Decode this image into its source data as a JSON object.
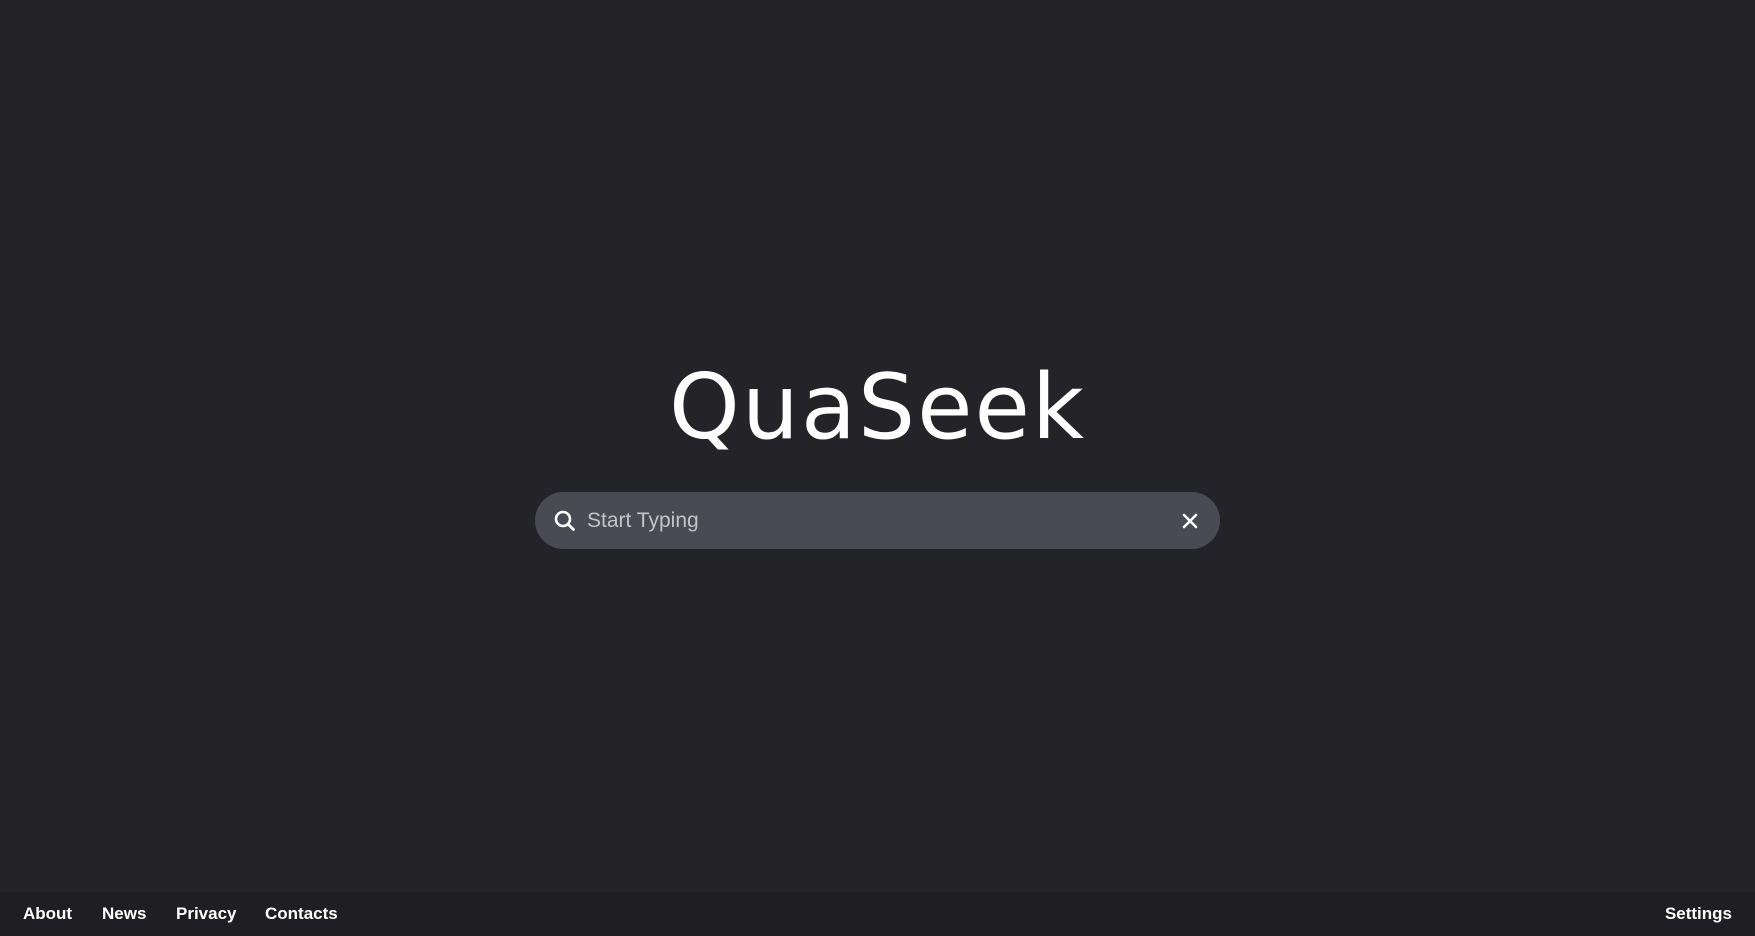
{
  "logo": {
    "text": "QuaSeek"
  },
  "search": {
    "placeholder": "Start Typing",
    "value": ""
  },
  "icons": {
    "search": "search-icon",
    "clear": "close-icon"
  },
  "footer": {
    "links": [
      {
        "label": "About"
      },
      {
        "label": "News"
      },
      {
        "label": "Privacy"
      },
      {
        "label": "Contacts"
      }
    ],
    "settings_label": "Settings"
  },
  "colors": {
    "background": "#232328",
    "footer_background": "#1f1f23",
    "search_background": "#4a4a55",
    "text": "#ffffff",
    "placeholder": "#c2c2ca"
  }
}
